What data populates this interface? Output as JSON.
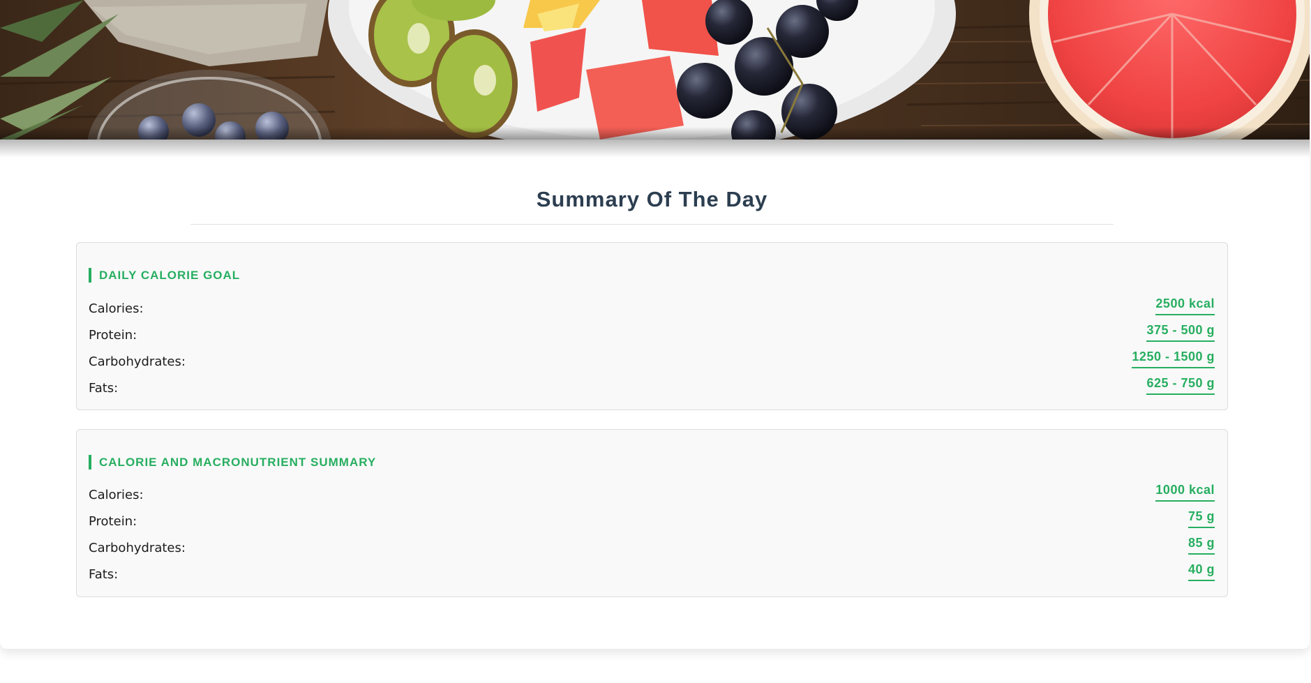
{
  "hero": {
    "image": "fruit-bowl-photo"
  },
  "page_title": "Summary Of The Day",
  "colors": {
    "accent": "#27ae60",
    "title": "#2c3e50",
    "panel_bg": "#f9f9f9"
  },
  "goal": {
    "heading": "DAILY CALORIE GOAL",
    "rows": [
      {
        "label": "Calories:",
        "value": "2500 kcal"
      },
      {
        "label": "Protein:",
        "value": "375 - 500 g"
      },
      {
        "label": "Carbohydrates:",
        "value": "1250 - 1500 g"
      },
      {
        "label": "Fats:",
        "value": "625 - 750 g"
      }
    ]
  },
  "summary": {
    "heading": "CALORIE AND MACRONUTRIENT SUMMARY",
    "rows": [
      {
        "label": "Calories:",
        "value": "1000 kcal"
      },
      {
        "label": "Protein:",
        "value": "75 g"
      },
      {
        "label": "Carbohydrates:",
        "value": "85 g"
      },
      {
        "label": "Fats:",
        "value": "40 g"
      }
    ]
  }
}
